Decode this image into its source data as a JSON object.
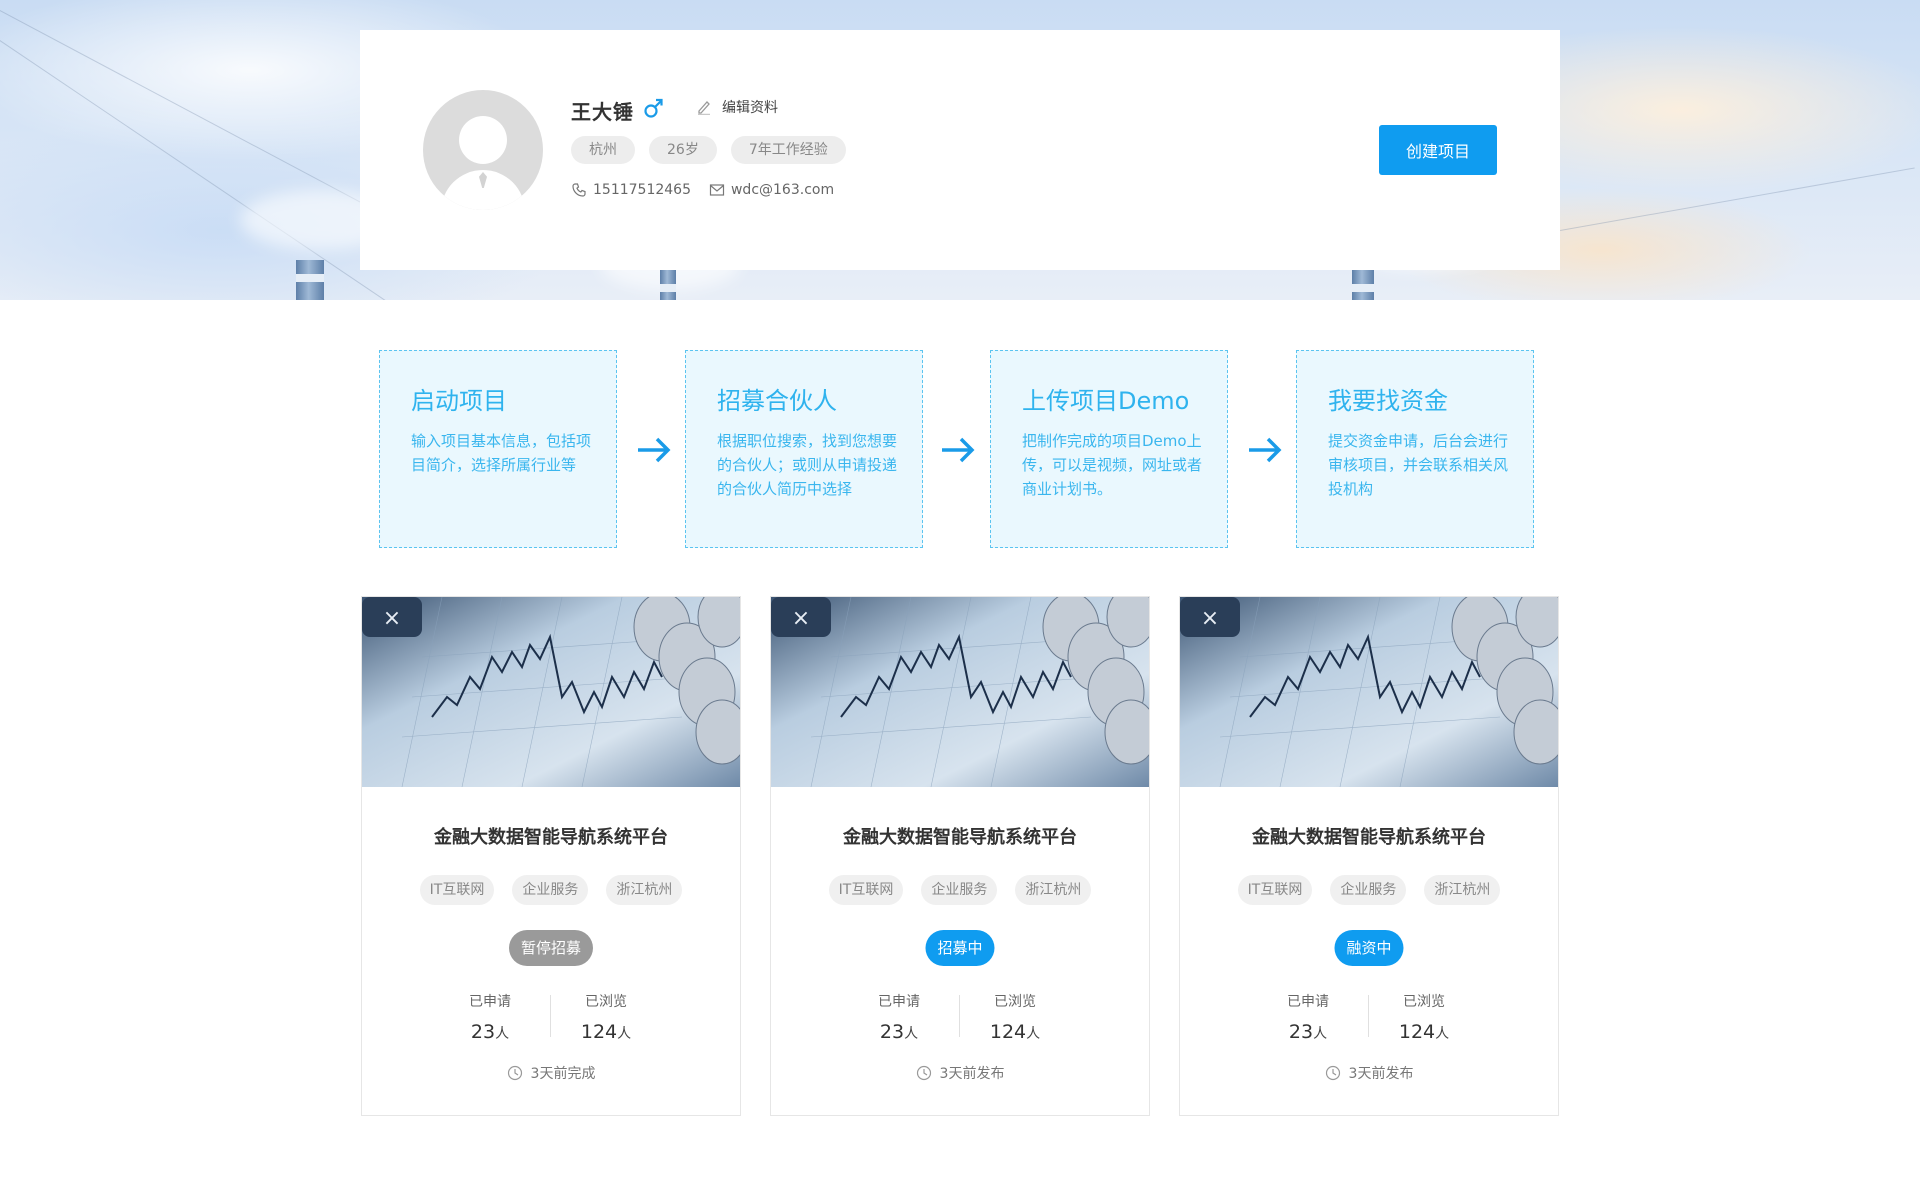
{
  "profile": {
    "name": "王大锤",
    "gender_icon": "male-icon",
    "edit_label": "编辑资料",
    "tags": [
      "杭州",
      "26岁",
      "7年工作经验"
    ],
    "phone": "15117512465",
    "email": "wdc@163.com",
    "create_button": "创建项目"
  },
  "steps": [
    {
      "title": "启动项目",
      "desc": "输入项目基本信息，包括项目简介，选择所属行业等"
    },
    {
      "title": "招募合伙人",
      "desc": "根据职位搜索，找到您想要的合伙人；或则从申请投递的合伙人简历中选择"
    },
    {
      "title": "上传项目Demo",
      "desc": "把制作完成的项目Demo上传，可以是视频，网址或者商业计划书。"
    },
    {
      "title": "我要找资金",
      "desc": "提交资金申请，后台会进行审核项目，并会联系相关风投机构"
    }
  ],
  "projects": [
    {
      "title": "金融大数据智能导航系统平台",
      "tags": [
        "IT互联网",
        "企业服务",
        "浙江杭州"
      ],
      "status": "暂停招募",
      "applied_label": "已申请",
      "applied": "23",
      "applied_unit": "人",
      "viewed_label": "已浏览",
      "viewed": "124",
      "viewed_unit": "人",
      "time": "3天前完成"
    },
    {
      "title": "金融大数据智能导航系统平台",
      "tags": [
        "IT互联网",
        "企业服务",
        "浙江杭州"
      ],
      "status": "招募中",
      "applied_label": "已申请",
      "applied": "23",
      "applied_unit": "人",
      "viewed_label": "已浏览",
      "viewed": "124",
      "viewed_unit": "人",
      "time": "3天前发布"
    },
    {
      "title": "金融大数据智能导航系统平台",
      "tags": [
        "IT互联网",
        "企业服务",
        "浙江杭州"
      ],
      "status": "融资中",
      "applied_label": "已申请",
      "applied": "23",
      "applied_unit": "人",
      "viewed_label": "已浏览",
      "viewed": "124",
      "viewed_unit": "人",
      "time": "3天前发布"
    }
  ],
  "colors": {
    "accent": "#0f9cf0",
    "step_text": "#2fb3ee",
    "status_paused": "#9a9a9a",
    "status_active": "#0f9cf0"
  }
}
